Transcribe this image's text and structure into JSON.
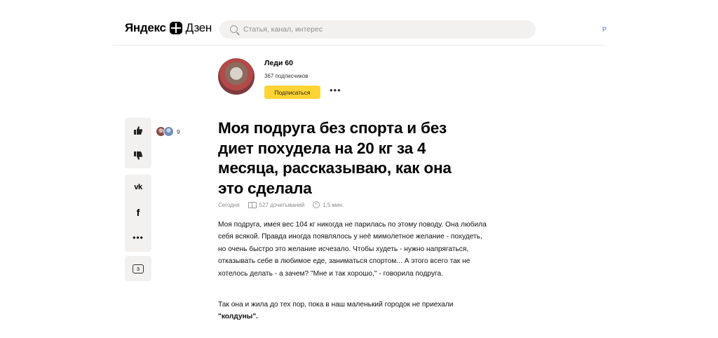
{
  "header": {
    "logo_word1": "Яндекс",
    "logo_word2": "Дзен",
    "search_placeholder": "Статья, канал, интерес",
    "edge_text": "Р"
  },
  "channel": {
    "name": "Леди 60",
    "subscribers": "367 подписчиков",
    "subscribe_label": "Подписаться",
    "more_label": "•••"
  },
  "actions": {
    "like_count": "9",
    "comments_count": "3",
    "vk_label": "vk",
    "fb_label": "f",
    "more_label": "•••"
  },
  "article": {
    "title": "Моя подруга без спорта и без диет похудела на 20 кг за 4 месяца, рассказываю, как она это сделала",
    "date": "Сегодня",
    "reads": "527 дочитываний",
    "read_time": "1,5 мин.",
    "paragraph1": "Моя подруга, имея вес 104 кг никогда не парилась по этому поводу. Она любила себя всякой. Правда иногда появлялось у неё мимолетное желание - похудеть, но очень быстро это желание исчезало. Чтобы худеть - нужно напрягаться, отказывать себе в любимое еде, заниматься спортом... А этого всего так не хотелось делать - а зачем? \"Мне и так хорошо,\" - говорила подруга.",
    "paragraph2_text": "Так она и жила до тех пор, пока в наш маленький городок не приехали ",
    "paragraph2_bold": "\"колдуны\"."
  },
  "colors": {
    "subscribe_bg": "#ffd333",
    "panel_bg": "#f2f1ef",
    "link": "#2a7de1"
  }
}
